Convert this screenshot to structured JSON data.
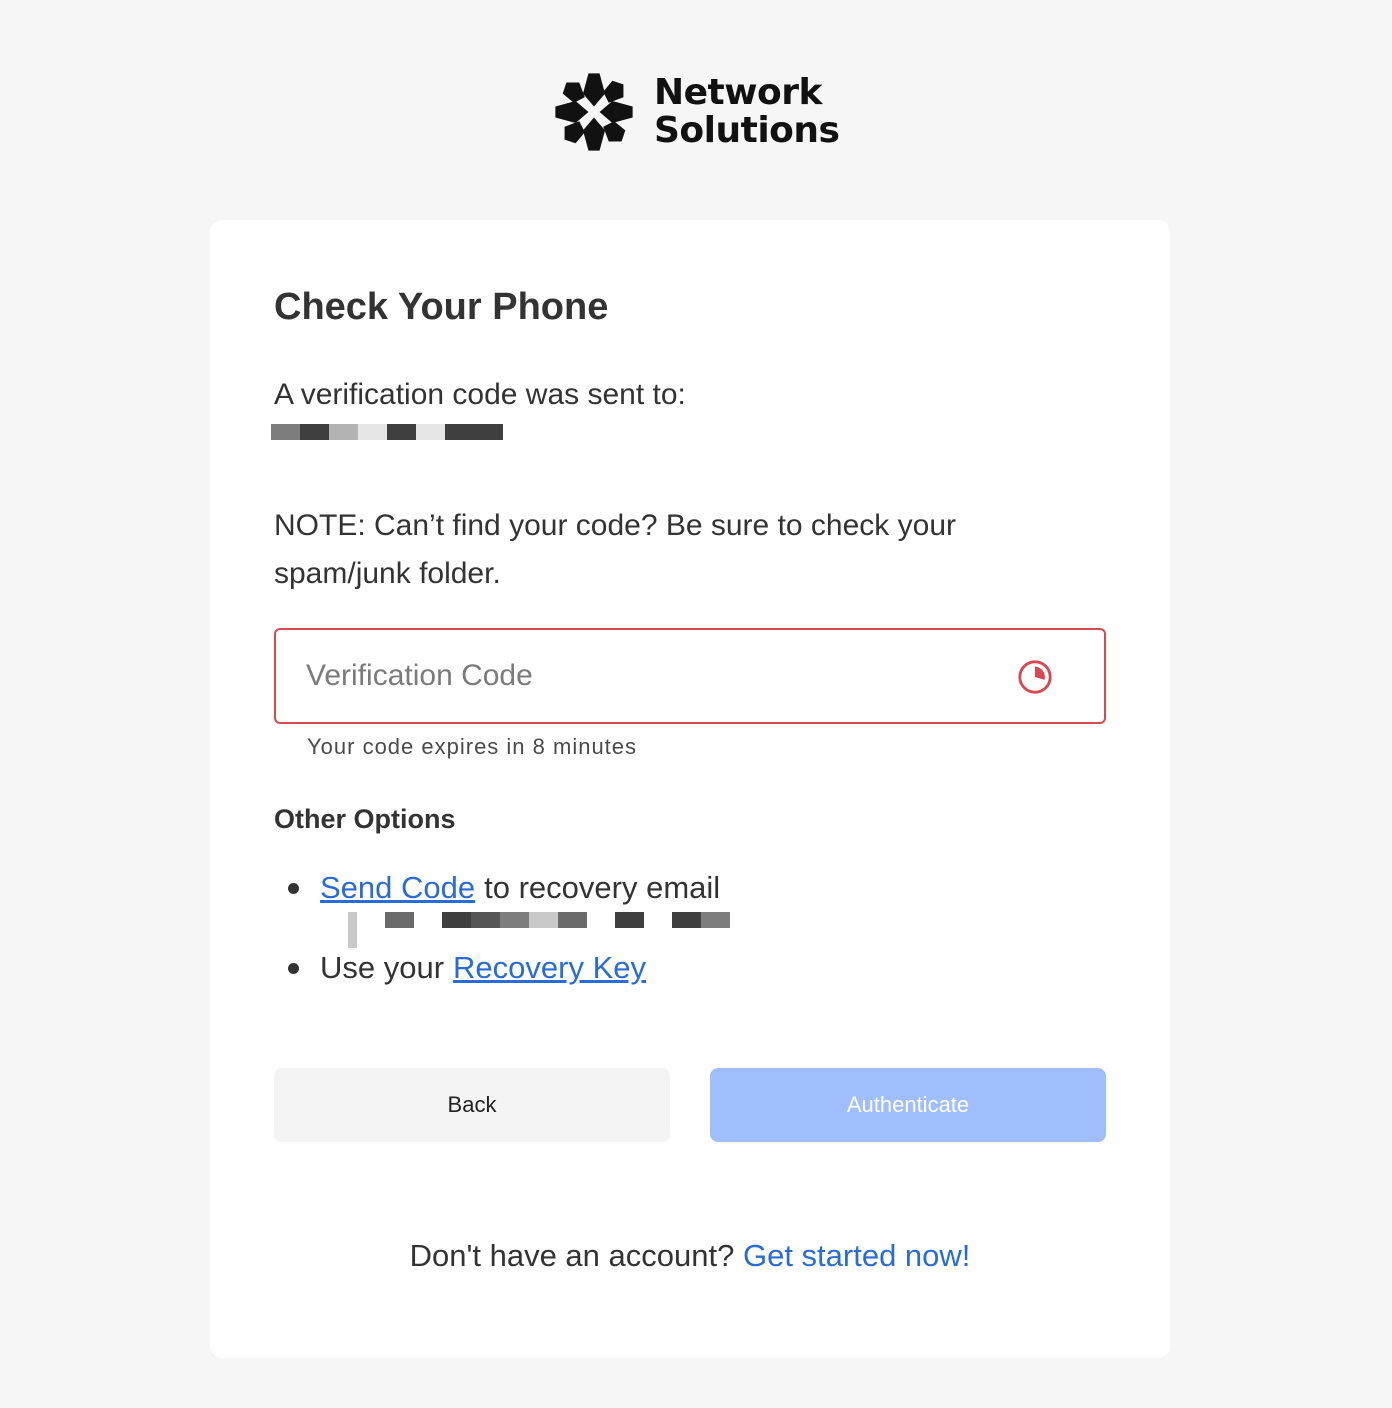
{
  "brand": {
    "name_line1": "Network",
    "name_line2": "Solutions",
    "logo_icon": "network-solutions-logo-icon"
  },
  "card": {
    "title": "Check Your Phone",
    "sent_to_label": "A verification code was sent to:",
    "note": "NOTE: Can’t find your code? Be sure to check your spam/junk folder."
  },
  "code_field": {
    "placeholder": "Verification Code",
    "value": "",
    "icon": "timer-icon",
    "expires_text": "Your code expires in 8 minutes",
    "border_color": "#d9474f"
  },
  "other_options": {
    "title": "Other Options",
    "send_code_link": "Send Code",
    "send_code_suffix": "to recovery email",
    "recovery_prefix": "Use your",
    "recovery_link": "Recovery Key"
  },
  "buttons": {
    "back_label": "Back",
    "authenticate_label": "Authenticate"
  },
  "footer": {
    "prompt": "Don't have an account?",
    "link": "Get started now!"
  },
  "colors": {
    "link": "#2a6cd6",
    "authenticate_bg": "#9fbefb",
    "page_bg": "#f6f6f6"
  }
}
